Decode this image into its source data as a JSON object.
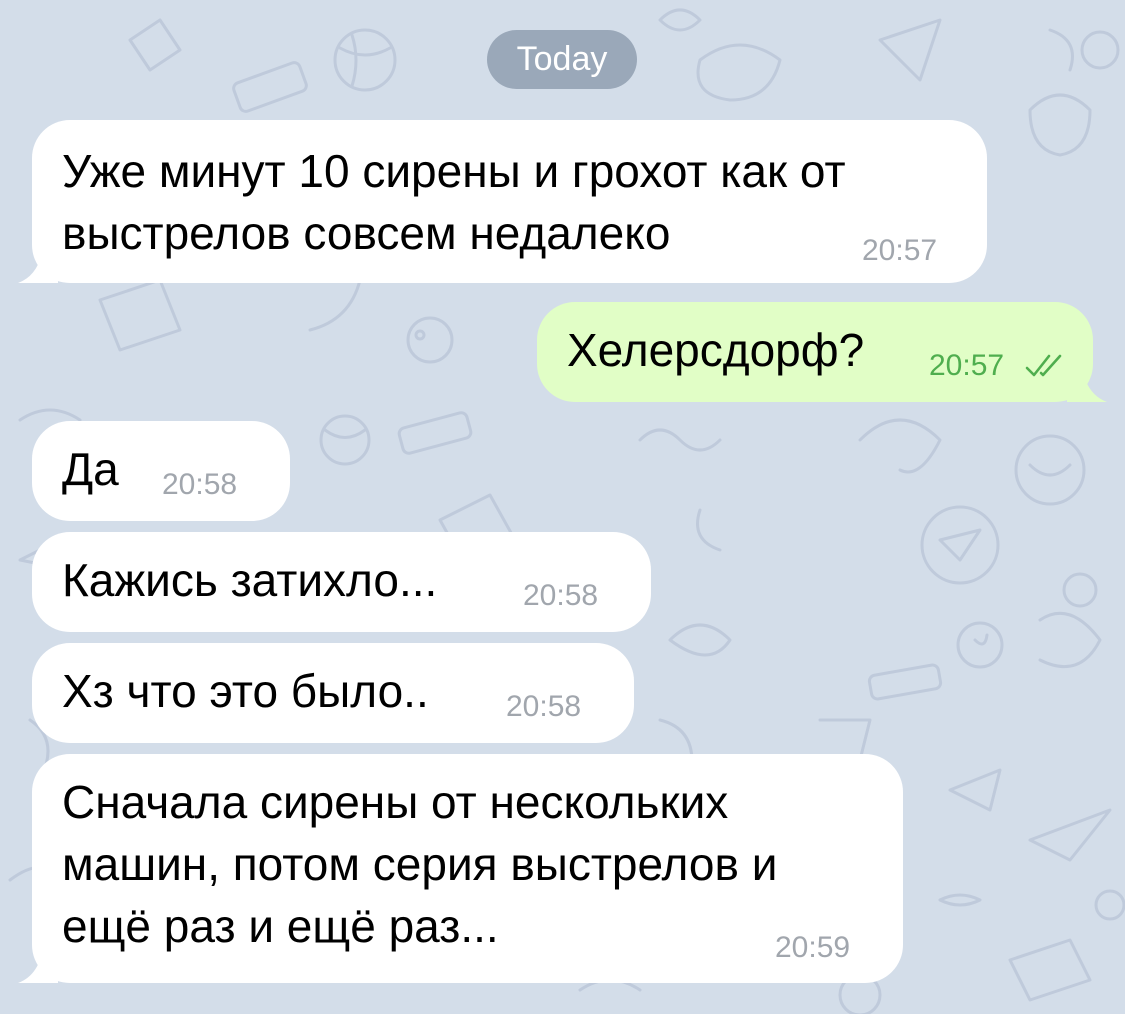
{
  "date_separator": "Today",
  "messages": [
    {
      "direction": "incoming",
      "text": "Уже минут 10 сирены и грохот как от\nвыстрелов совсем недалеко",
      "time": "20:57"
    },
    {
      "direction": "outgoing",
      "text": "Хелерсдорф?",
      "time": "20:57",
      "status": "read"
    },
    {
      "direction": "incoming",
      "text": "Да",
      "time": "20:58"
    },
    {
      "direction": "incoming",
      "text": "Кажись затихло...",
      "time": "20:58"
    },
    {
      "direction": "incoming",
      "text": "Хз что это было..",
      "time": "20:58"
    },
    {
      "direction": "incoming",
      "text": "Сначала сирены от нескольких\nмашин, потом серия выстрелов и\nещё раз и ещё раз...",
      "time": "20:59"
    }
  ],
  "colors": {
    "background": "#d3dde9",
    "incoming_bubble": "#ffffff",
    "outgoing_bubble": "#e1fec6",
    "outgoing_time": "#4fae4e",
    "incoming_time": "#a1a6ad"
  },
  "icons": {
    "read_status": "double-check-icon"
  }
}
